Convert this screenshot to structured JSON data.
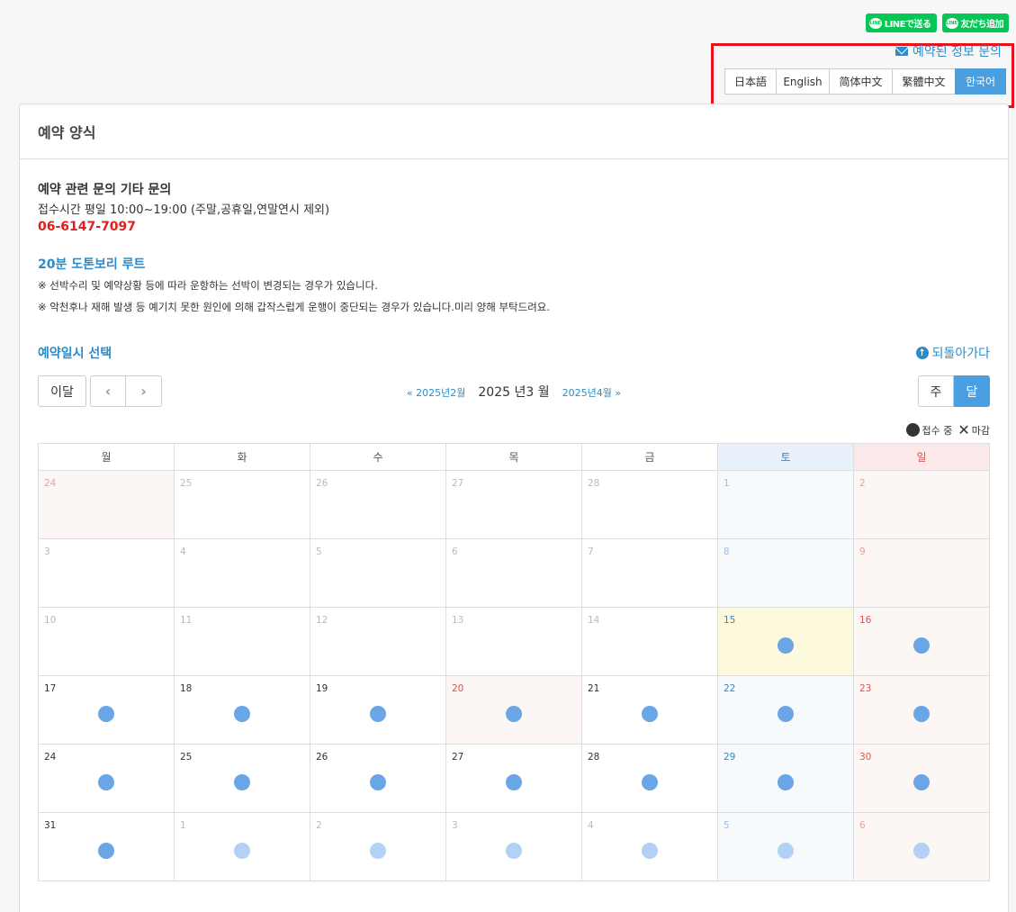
{
  "line_buttons": {
    "send": "LINEで送る",
    "add_friend": "友だち追加",
    "logo": "LINE"
  },
  "inquiry_link": "예약된 정보 문의",
  "languages": [
    "日本語",
    "English",
    "简体中文",
    "繁體中文",
    "한국어"
  ],
  "active_language": "한국어",
  "card": {
    "title": "예약 양식"
  },
  "info": {
    "title": "예약 관련 문의 기타 문의",
    "hours": "접수시간 평일 10:00~19:00 (주말,공휴일,연말연시 제외)",
    "phone": "06-6147-7097"
  },
  "route": {
    "title": "20분 도톤보리 루트",
    "notes": [
      "※ 선박수리 및 예약상황 등에 따라 운항하는 선박이 변경되는 경우가 있습니다.",
      "※ 악천후나 재해 발생 등 예기치 못한 원인에 의해 갑작스럽게 운행이 중단되는 경우가 있습니다.미리 양해 부탁드려요."
    ]
  },
  "calendar": {
    "section_title": "예약일시 선택",
    "back_label": "되돌아가다",
    "this_month": "이달",
    "prev_icon": "chevron-left-icon",
    "next_icon": "chevron-right-icon",
    "prev_month": "« 2025년2월",
    "current_month": "2025 년3 월",
    "next_month": "2025년4월 »",
    "view_week": "주",
    "view_month": "달",
    "legend_open": "접수 중",
    "legend_closed": "마감",
    "weekdays": [
      "월",
      "화",
      "수",
      "목",
      "금",
      "토",
      "일"
    ],
    "colors": {
      "accent": "#4a9fe0",
      "available_dot": "#6aa5e6",
      "available_dot_next_month": "#b3d1f5",
      "saturday": "#2b8cc8",
      "sunday": "#e05050",
      "today": "#fcf9dc"
    },
    "weeks": [
      [
        {
          "d": "24",
          "muted": true,
          "hol": true,
          "dot": ""
        },
        {
          "d": "25",
          "muted": true,
          "dot": ""
        },
        {
          "d": "26",
          "muted": true,
          "dot": ""
        },
        {
          "d": "27",
          "muted": true,
          "dot": ""
        },
        {
          "d": "28",
          "muted": true,
          "dot": ""
        },
        {
          "d": "1",
          "muted": true,
          "dot": ""
        },
        {
          "d": "2",
          "muted": true,
          "dot": ""
        }
      ],
      [
        {
          "d": "3",
          "muted": true,
          "dot": ""
        },
        {
          "d": "4",
          "muted": true,
          "dot": ""
        },
        {
          "d": "5",
          "muted": true,
          "dot": ""
        },
        {
          "d": "6",
          "muted": true,
          "dot": ""
        },
        {
          "d": "7",
          "muted": true,
          "dot": ""
        },
        {
          "d": "8",
          "muted": true,
          "dot": ""
        },
        {
          "d": "9",
          "muted": true,
          "dot": ""
        }
      ],
      [
        {
          "d": "10",
          "muted": true,
          "dot": ""
        },
        {
          "d": "11",
          "muted": true,
          "dot": ""
        },
        {
          "d": "12",
          "muted": true,
          "dot": ""
        },
        {
          "d": "13",
          "muted": true,
          "dot": ""
        },
        {
          "d": "14",
          "muted": true,
          "dot": ""
        },
        {
          "d": "15",
          "today": true,
          "dot": "open"
        },
        {
          "d": "16",
          "dot": "open"
        }
      ],
      [
        {
          "d": "17",
          "dot": "open"
        },
        {
          "d": "18",
          "dot": "open"
        },
        {
          "d": "19",
          "dot": "open"
        },
        {
          "d": "20",
          "hol": true,
          "dot": "open"
        },
        {
          "d": "21",
          "dot": "open"
        },
        {
          "d": "22",
          "dot": "open"
        },
        {
          "d": "23",
          "dot": "open"
        }
      ],
      [
        {
          "d": "24",
          "dot": "open"
        },
        {
          "d": "25",
          "dot": "open"
        },
        {
          "d": "26",
          "dot": "open"
        },
        {
          "d": "27",
          "dot": "open"
        },
        {
          "d": "28",
          "dot": "open"
        },
        {
          "d": "29",
          "dot": "open"
        },
        {
          "d": "30",
          "dot": "open"
        }
      ],
      [
        {
          "d": "31",
          "dot": "open"
        },
        {
          "d": "1",
          "muted": true,
          "dot": "light"
        },
        {
          "d": "2",
          "muted": true,
          "dot": "light"
        },
        {
          "d": "3",
          "muted": true,
          "dot": "light"
        },
        {
          "d": "4",
          "muted": true,
          "dot": "light"
        },
        {
          "d": "5",
          "muted": true,
          "dot": "light"
        },
        {
          "d": "6",
          "muted": true,
          "dot": "light"
        }
      ]
    ]
  }
}
